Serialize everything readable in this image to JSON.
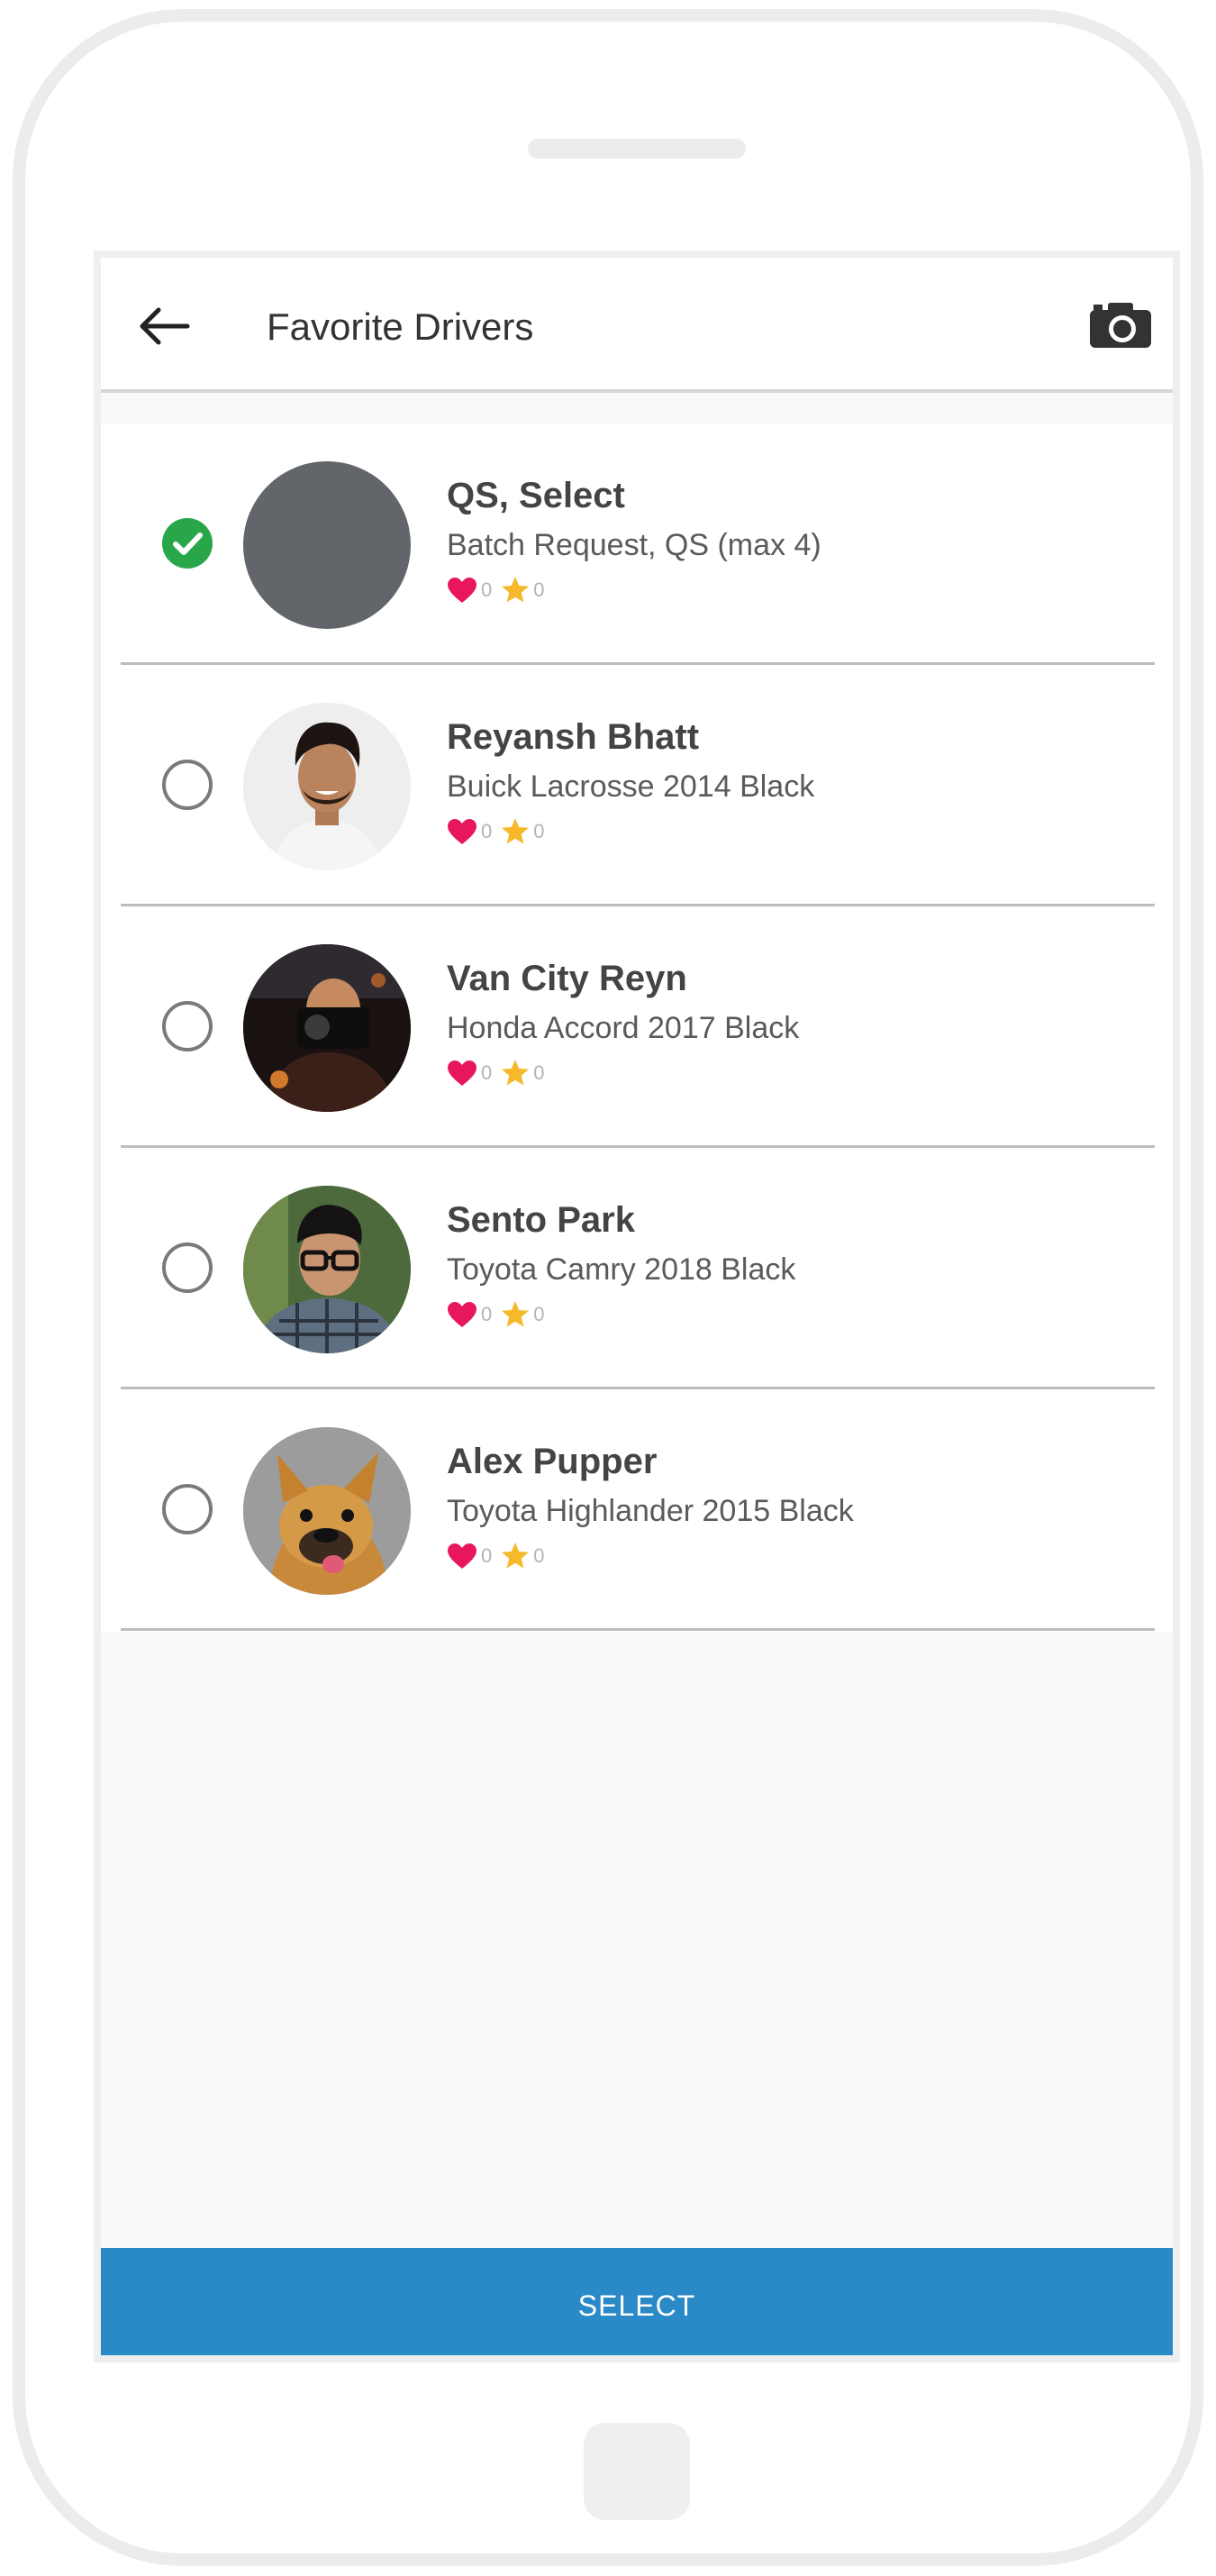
{
  "header": {
    "title": "Favorite Drivers",
    "back_icon": "arrow-left-icon",
    "camera_icon": "camera-icon"
  },
  "drivers": [
    {
      "name": "QS, Select",
      "vehicle": "Batch Request, QS (max 4)",
      "hearts": "0",
      "stars": "0",
      "selected": true,
      "avatar": "gray-placeholder"
    },
    {
      "name": "Reyansh Bhatt",
      "vehicle": "Buick Lacrosse 2014 Black",
      "hearts": "0",
      "stars": "0",
      "selected": false,
      "avatar": "photo-man-smiling"
    },
    {
      "name": "Van City Reyn",
      "vehicle": "Honda Accord 2017 Black",
      "hearts": "0",
      "stars": "0",
      "selected": false,
      "avatar": "photo-man-camera"
    },
    {
      "name": "Sento Park",
      "vehicle": "Toyota Camry 2018 Black",
      "hearts": "0",
      "stars": "0",
      "selected": false,
      "avatar": "photo-man-glasses"
    },
    {
      "name": "Alex Pupper",
      "vehicle": "Toyota Highlander 2015 Black",
      "hearts": "0",
      "stars": "0",
      "selected": false,
      "avatar": "photo-dog"
    }
  ],
  "footer": {
    "select_label": "SELECT"
  },
  "colors": {
    "accent": "#2a89c7",
    "check": "#2aa64a",
    "heart": "#e8175d",
    "star": "#f6b92b"
  }
}
